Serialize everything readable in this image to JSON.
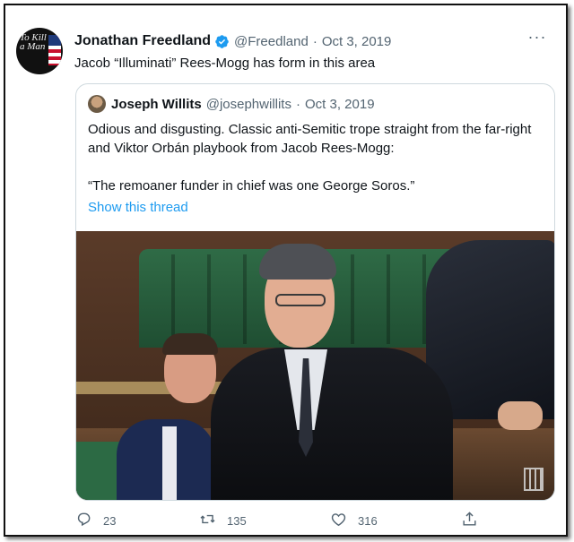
{
  "tweet": {
    "author_name": "Jonathan Freedland",
    "author_handle": "@Freedland",
    "separator": "·",
    "date": "Oct 3, 2019",
    "avatar_text": "To Kill a Man",
    "text": "Jacob “Illuminati” Rees-Mogg has form in this area",
    "more_icon": "more-dots-icon",
    "verified_icon": "verified-badge-icon",
    "accent_color": "#1d9bf0"
  },
  "quote": {
    "author_name": "Joseph Willits",
    "author_handle": "@josephwillits",
    "separator": "·",
    "date": "Oct 3, 2019",
    "text": "Odious and disgusting. Classic anti-Semitic trope straight from the far-right and Viktor Orbán playbook from Jacob Rees-Mogg:",
    "quoted_line": "“The remoaner funder in chief was one George Soros.”",
    "show_thread": "Show this thread"
  },
  "actions": {
    "reply_count": "23",
    "retweet_count": "135",
    "like_count": "316",
    "icons": [
      "reply-icon",
      "retweet-icon",
      "like-icon",
      "share-icon"
    ]
  }
}
